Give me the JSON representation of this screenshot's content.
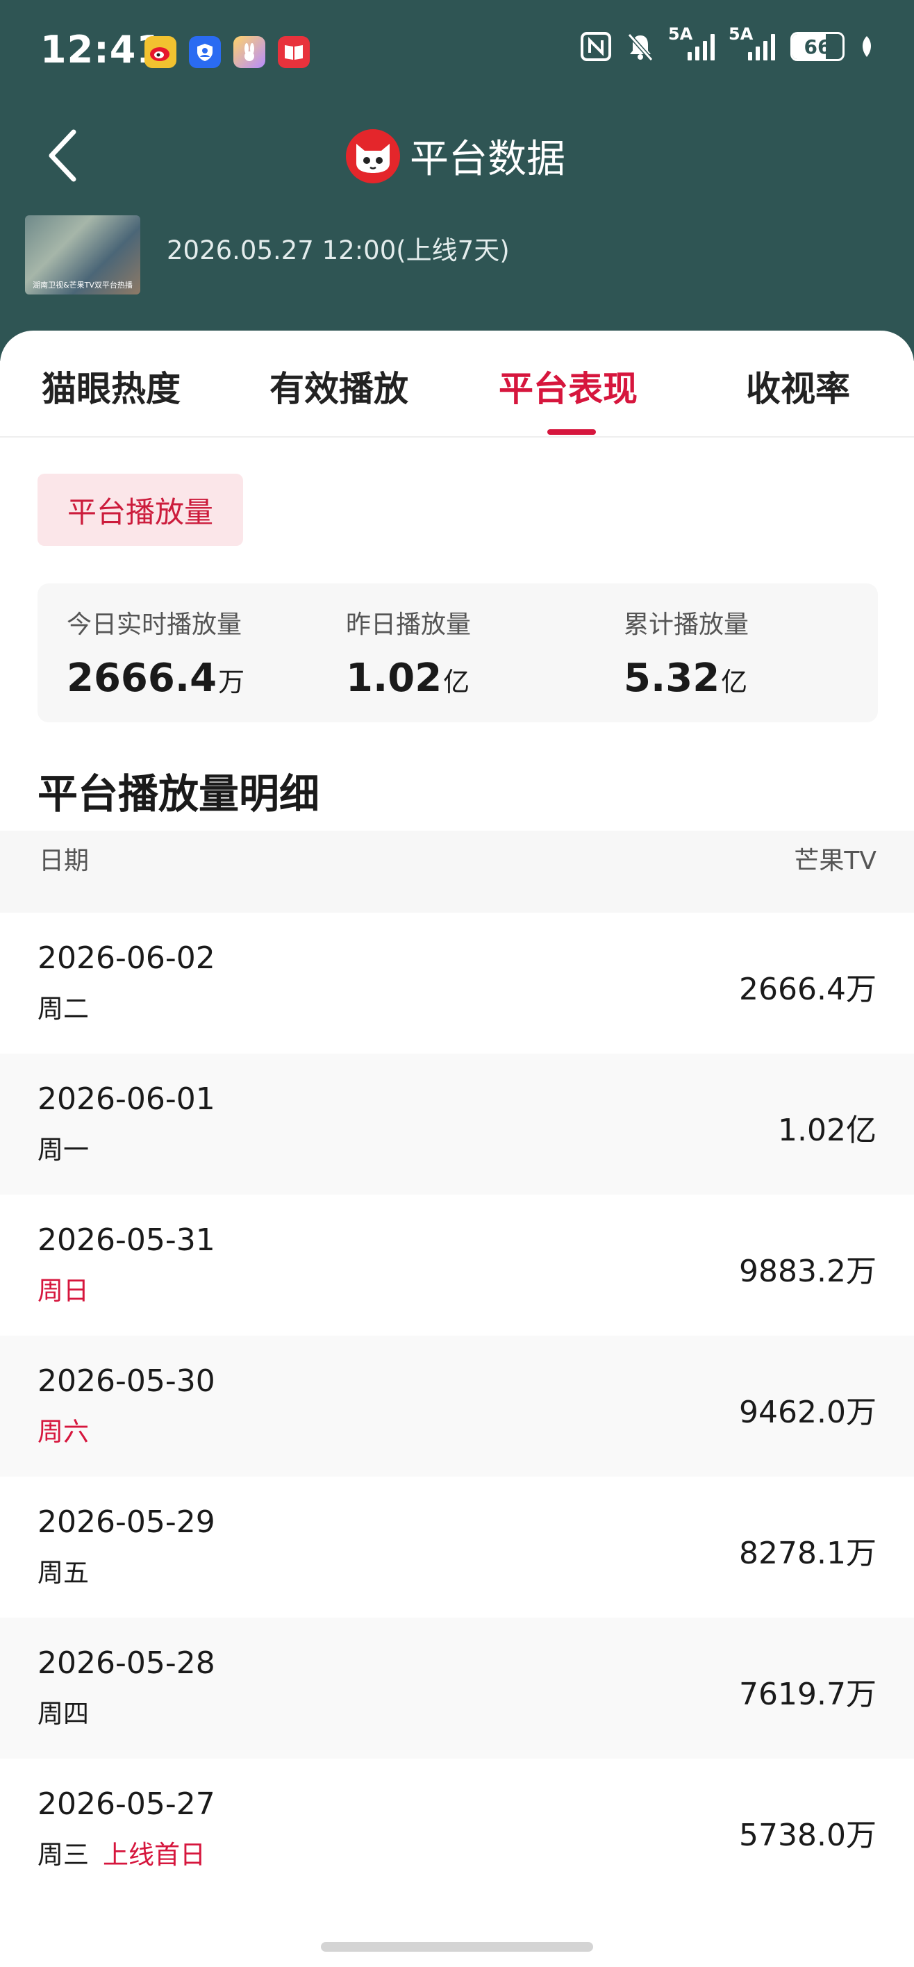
{
  "status_bar": {
    "time": "12:41",
    "signal1_label": "5A",
    "signal2_label": "5A",
    "battery_percent": "66",
    "battery_level": 0.66
  },
  "header": {
    "title": "平台数据",
    "show_meta": "2026.05.27 12:00(上线7天)",
    "poster_caption": "湖南卫视&芒果TV双平台热播"
  },
  "tabs": [
    {
      "label": "猫眼热度",
      "active": false
    },
    {
      "label": "有效播放",
      "active": false
    },
    {
      "label": "平台表现",
      "active": true
    },
    {
      "label": "收视率",
      "active": false
    }
  ],
  "filter_chip": "平台播放量",
  "stats": {
    "today": {
      "label": "今日实时播放量",
      "value": "2666.4",
      "unit": "万"
    },
    "yesterday": {
      "label": "昨日播放量",
      "value": "1.02",
      "unit": "亿"
    },
    "total": {
      "label": "累计播放量",
      "value": "5.32",
      "unit": "亿"
    }
  },
  "detail": {
    "title": "平台播放量明细",
    "col_date": "日期",
    "col_platform": "芒果TV",
    "rows": [
      {
        "date": "2026-06-02",
        "weekday": "周二",
        "weekend": false,
        "note": "",
        "value": "2666.4万"
      },
      {
        "date": "2026-06-01",
        "weekday": "周一",
        "weekend": false,
        "note": "",
        "value": "1.02亿"
      },
      {
        "date": "2026-05-31",
        "weekday": "周日",
        "weekend": true,
        "note": "",
        "value": "9883.2万"
      },
      {
        "date": "2026-05-30",
        "weekday": "周六",
        "weekend": true,
        "note": "",
        "value": "9462.0万"
      },
      {
        "date": "2026-05-29",
        "weekday": "周五",
        "weekend": false,
        "note": "",
        "value": "8278.1万"
      },
      {
        "date": "2026-05-28",
        "weekday": "周四",
        "weekend": false,
        "note": "",
        "value": "7619.7万"
      },
      {
        "date": "2026-05-27",
        "weekday": "周三",
        "weekend": false,
        "note": "上线首日",
        "value": "5738.0万"
      }
    ]
  },
  "colors": {
    "header_bg": "#2f5554",
    "accent": "#d6163d",
    "chip_bg": "#fbe6e9"
  }
}
